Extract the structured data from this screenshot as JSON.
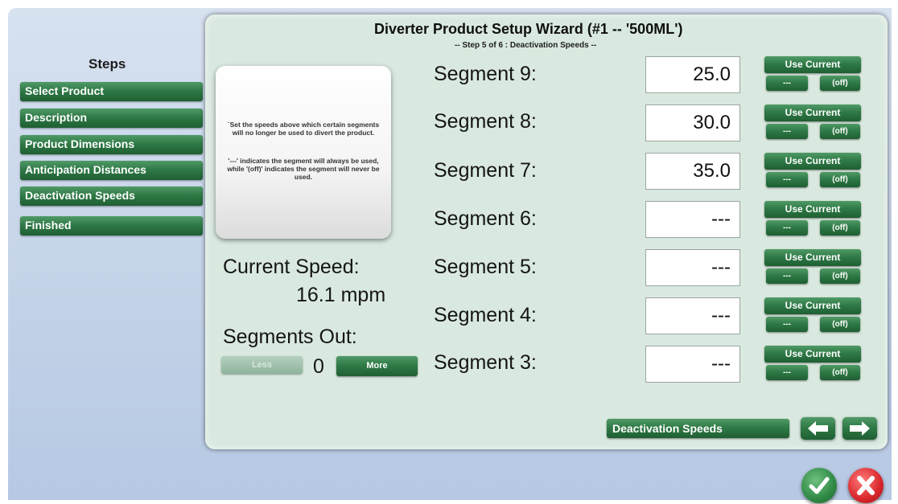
{
  "steps": {
    "title": "Steps",
    "items": [
      {
        "label": "Select Product"
      },
      {
        "label": "Description"
      },
      {
        "label": "Product Dimensions"
      },
      {
        "label": "Anticipation Distances"
      },
      {
        "label": "Deactivation Speeds",
        "active": true
      },
      {
        "label": "Finished"
      }
    ]
  },
  "wizard": {
    "title": "Diverter Product Setup Wizard (#1 -- '500ML')",
    "subtitle": "-- Step 5 of 6 : Deactivation Speeds --"
  },
  "info": {
    "text1": "`Set the speeds above which certain segments will no longer be used to divert the product.",
    "text2": "'---' indicates the segment will always be used, while '(off)' indicates the segment will never be used."
  },
  "status": {
    "current_speed_label": "Current Speed:",
    "current_speed_value": "16.1 mpm",
    "segments_out_label": "Segments Out:",
    "segments_out_value": "0",
    "less_label": "Less",
    "more_label": "More"
  },
  "segments": [
    {
      "label": "Segment 9:",
      "value": "25.0"
    },
    {
      "label": "Segment 8:",
      "value": "30.0"
    },
    {
      "label": "Segment 7:",
      "value": "35.0"
    },
    {
      "label": "Segment 6:",
      "value": "---"
    },
    {
      "label": "Segment 5:",
      "value": "---"
    },
    {
      "label": "Segment 4:",
      "value": "---"
    },
    {
      "label": "Segment 3:",
      "value": "---"
    }
  ],
  "segment_buttons": {
    "use_current": "Use Current",
    "dash": "---",
    "off": "(off)"
  },
  "footer": {
    "step_name": "Deactivation Speeds",
    "prev_icon": "left-arrow-icon",
    "next_icon": "right-arrow-icon",
    "ok_icon": "checkmark-icon",
    "cancel_icon": "x-icon"
  },
  "colors": {
    "button_green": "#2f7a46",
    "active_highlight": "#e0262b",
    "panel_bg": "#d9e9df",
    "screen_bg": "#c3d2e8"
  }
}
